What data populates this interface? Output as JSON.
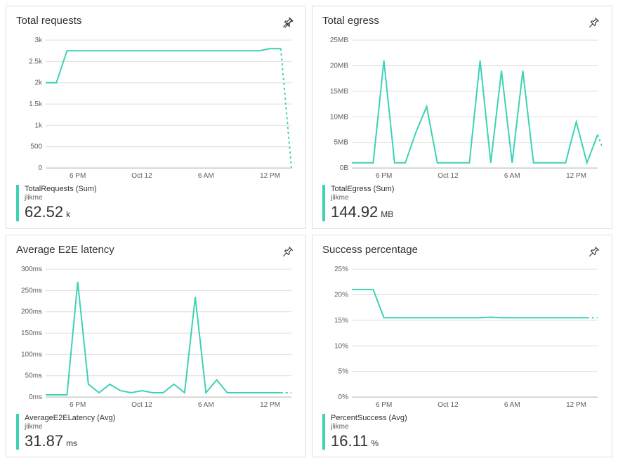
{
  "tiles": [
    {
      "id": "requests",
      "title": "Total requests",
      "summary": {
        "metric": "TotalRequests (Sum)",
        "sub": "jlikme",
        "value": "62.52",
        "unit": "k"
      }
    },
    {
      "id": "egress",
      "title": "Total egress",
      "summary": {
        "metric": "TotalEgress (Sum)",
        "sub": "jlikme",
        "value": "144.92",
        "unit": "MB"
      }
    },
    {
      "id": "latency",
      "title": "Average E2E latency",
      "summary": {
        "metric": "AverageE2ELatency (Avg)",
        "sub": "jlikme",
        "value": "31.87",
        "unit": "ms"
      }
    },
    {
      "id": "success",
      "title": "Success percentage",
      "summary": {
        "metric": "PercentSuccess (Avg)",
        "sub": "jlikme",
        "value": "16.11",
        "unit": "%"
      }
    }
  ],
  "x_labels": [
    "6 PM",
    "Oct 12",
    "6 AM",
    "12 PM"
  ],
  "chart_data": [
    {
      "type": "line",
      "title": "Total requests",
      "ylabel": "",
      "xlabel": "",
      "ylim": [
        0,
        3000
      ],
      "y_ticks": [
        0,
        500,
        1000,
        1500,
        2000,
        2500,
        3000
      ],
      "y_tick_labels": [
        "0",
        "500",
        "1k",
        "1.5k",
        "2k",
        "2.5k",
        "3k"
      ],
      "x": [
        0,
        1,
        2,
        3,
        4,
        5,
        6,
        7,
        8,
        9,
        10,
        11,
        12,
        13,
        14,
        15,
        16,
        17,
        18,
        19,
        20,
        21,
        22,
        23
      ],
      "x_tick_indices": [
        3,
        9,
        15,
        21
      ],
      "x_tick_labels": [
        "6 PM",
        "Oct 12",
        "6 AM",
        "12 PM"
      ],
      "series": [
        {
          "name": "TotalRequests (Sum)",
          "values": [
            2000,
            2000,
            2750,
            2750,
            2750,
            2750,
            2750,
            2750,
            2750,
            2750,
            2750,
            2750,
            2750,
            2750,
            2750,
            2750,
            2750,
            2750,
            2750,
            2750,
            2750,
            2800,
            2800,
            0
          ],
          "dashed_from_index": 22
        }
      ]
    },
    {
      "type": "line",
      "title": "Total egress",
      "ylabel": "",
      "xlabel": "",
      "ylim": [
        0,
        25
      ],
      "y_ticks": [
        0,
        5,
        10,
        15,
        20,
        25
      ],
      "y_tick_labels": [
        "0B",
        "5MB",
        "10MB",
        "15MB",
        "20MB",
        "25MB"
      ],
      "x": [
        0,
        1,
        2,
        3,
        4,
        5,
        6,
        7,
        8,
        9,
        10,
        11,
        12,
        13,
        14,
        15,
        16,
        17,
        18,
        19,
        20,
        21,
        22,
        23
      ],
      "x_tick_indices": [
        3,
        9,
        15,
        21
      ],
      "x_tick_labels": [
        "6 PM",
        "Oct 12",
        "6 AM",
        "12 PM"
      ],
      "series": [
        {
          "name": "TotalEgress (Sum)",
          "values": [
            1,
            1,
            1,
            21,
            1,
            1,
            7,
            12,
            1,
            1,
            1,
            1,
            21,
            1,
            19,
            1,
            19,
            1,
            1,
            1,
            1,
            9,
            1,
            6.5,
            1
          ],
          "dashed_from_index": 23
        }
      ]
    },
    {
      "type": "line",
      "title": "Average E2E latency",
      "ylabel": "",
      "xlabel": "",
      "ylim": [
        0,
        300
      ],
      "y_ticks": [
        0,
        50,
        100,
        150,
        200,
        250,
        300
      ],
      "y_tick_labels": [
        "0ms",
        "50ms",
        "100ms",
        "150ms",
        "200ms",
        "250ms",
        "300ms"
      ],
      "x": [
        0,
        1,
        2,
        3,
        4,
        5,
        6,
        7,
        8,
        9,
        10,
        11,
        12,
        13,
        14,
        15,
        16,
        17,
        18,
        19,
        20,
        21,
        22,
        23
      ],
      "x_tick_indices": [
        3,
        9,
        15,
        21
      ],
      "x_tick_labels": [
        "6 PM",
        "Oct 12",
        "6 AM",
        "12 PM"
      ],
      "series": [
        {
          "name": "AverageE2ELatency (Avg)",
          "values": [
            5,
            5,
            5,
            270,
            30,
            10,
            30,
            15,
            10,
            15,
            10,
            10,
            30,
            10,
            235,
            10,
            40,
            10,
            10,
            10,
            10,
            10,
            10,
            10
          ],
          "dashed_from_index": 22
        }
      ]
    },
    {
      "type": "line",
      "title": "Success percentage",
      "ylabel": "",
      "xlabel": "",
      "ylim": [
        0,
        25
      ],
      "y_ticks": [
        0,
        5,
        10,
        15,
        20,
        25
      ],
      "y_tick_labels": [
        "0%",
        "5%",
        "10%",
        "15%",
        "20%",
        "25%"
      ],
      "x": [
        0,
        1,
        2,
        3,
        4,
        5,
        6,
        7,
        8,
        9,
        10,
        11,
        12,
        13,
        14,
        15,
        16,
        17,
        18,
        19,
        20,
        21,
        22,
        23
      ],
      "x_tick_indices": [
        3,
        9,
        15,
        21
      ],
      "x_tick_labels": [
        "6 PM",
        "Oct 12",
        "6 AM",
        "12 PM"
      ],
      "series": [
        {
          "name": "PercentSuccess (Avg)",
          "values": [
            21,
            21,
            21,
            15.5,
            15.5,
            15.5,
            15.5,
            15.5,
            15.5,
            15.5,
            15.5,
            15.5,
            15.5,
            15.6,
            15.5,
            15.5,
            15.5,
            15.5,
            15.5,
            15.5,
            15.5,
            15.5,
            15.5,
            15.5
          ],
          "dashed_from_index": 22
        }
      ]
    }
  ]
}
